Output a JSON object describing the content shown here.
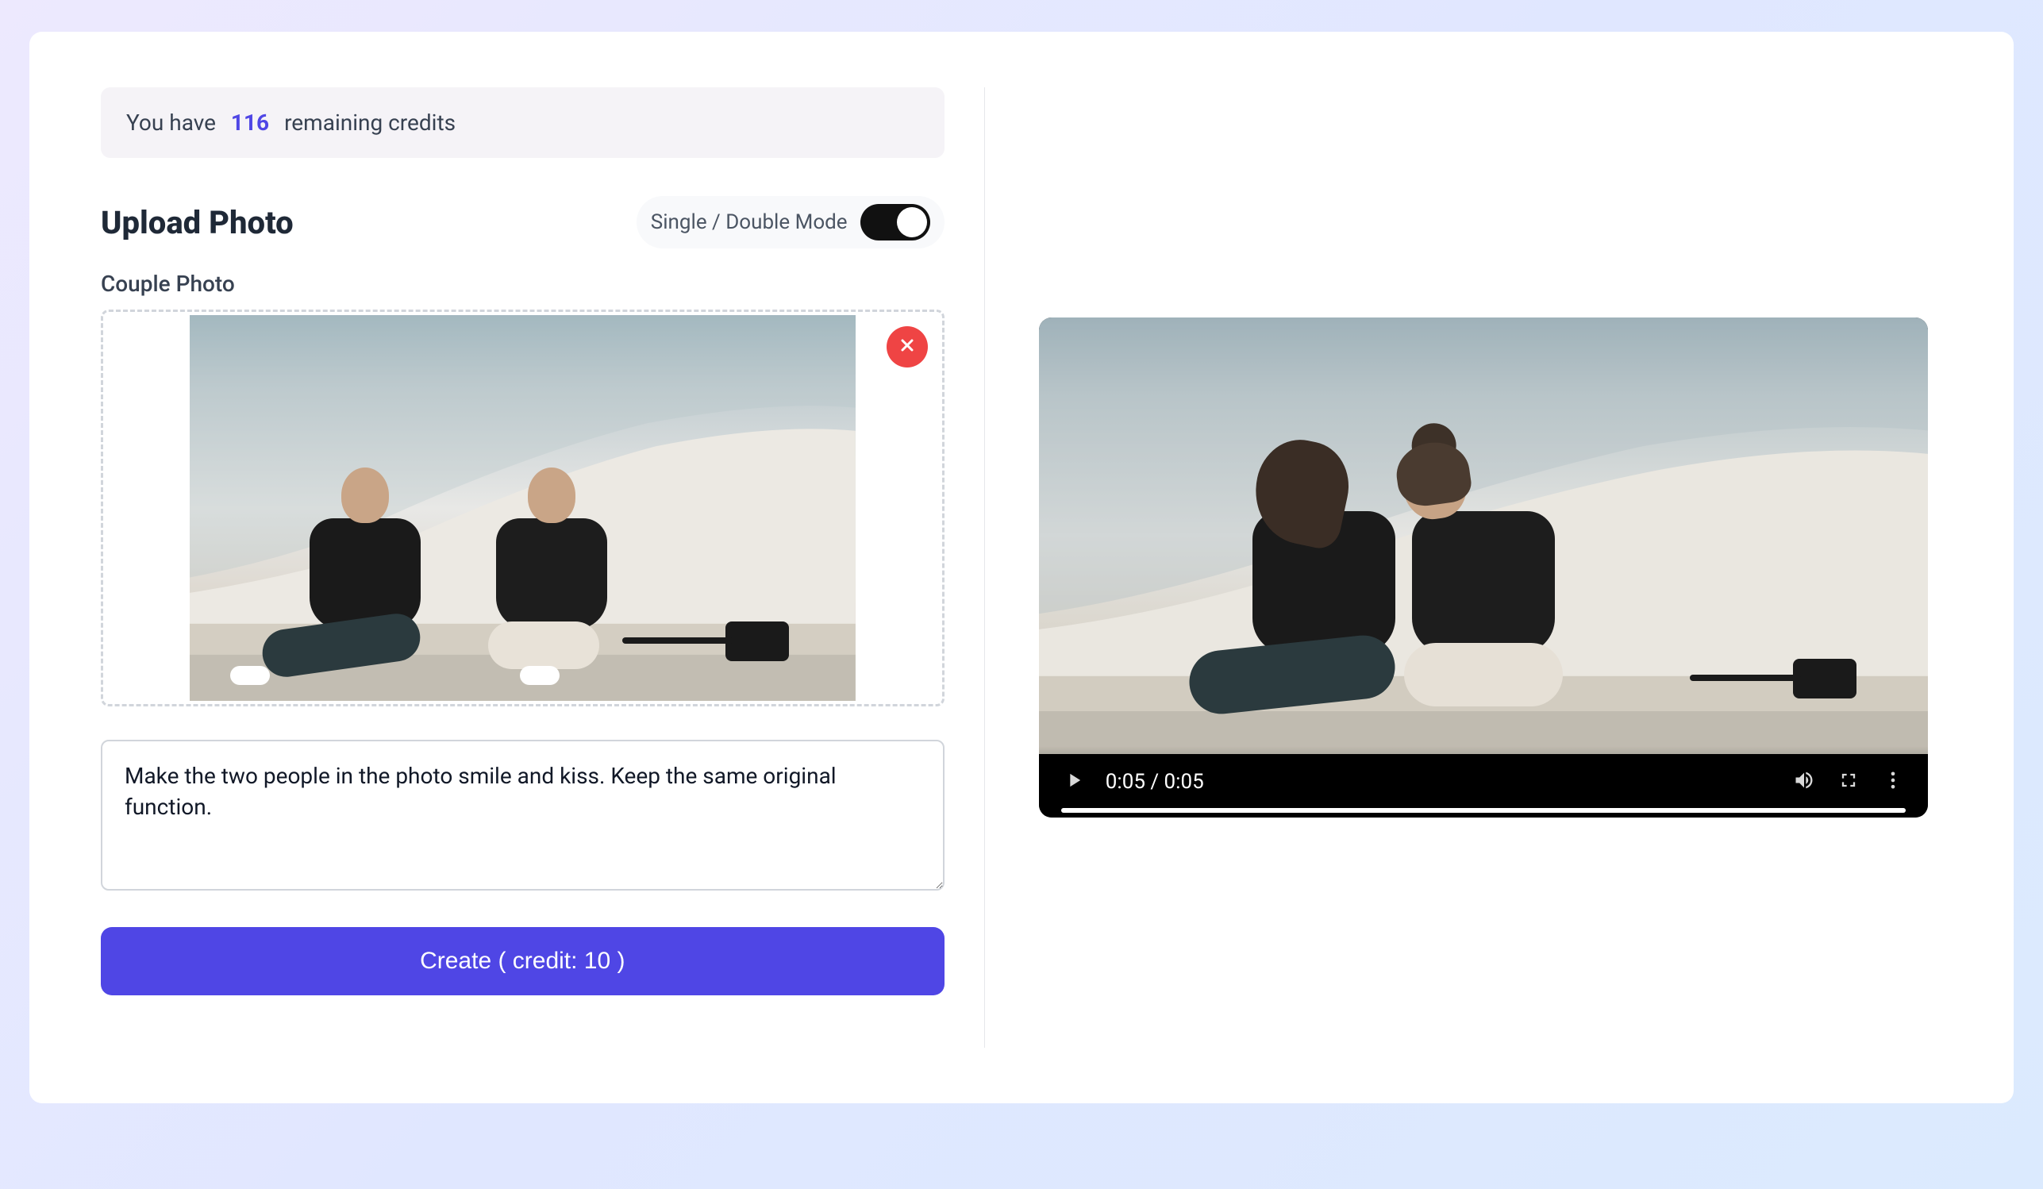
{
  "credits": {
    "prefix": "You have",
    "count": "116",
    "suffix": "remaining credits"
  },
  "upload": {
    "title": "Upload Photo",
    "mode_label": "Single / Double Mode",
    "section_label": "Couple Photo"
  },
  "prompt": {
    "value": "Make the two people in the photo smile and kiss. Keep the same original function."
  },
  "create_button": {
    "label": "Create ( credit: 10 )"
  },
  "video": {
    "time": "0:05 / 0:05"
  }
}
